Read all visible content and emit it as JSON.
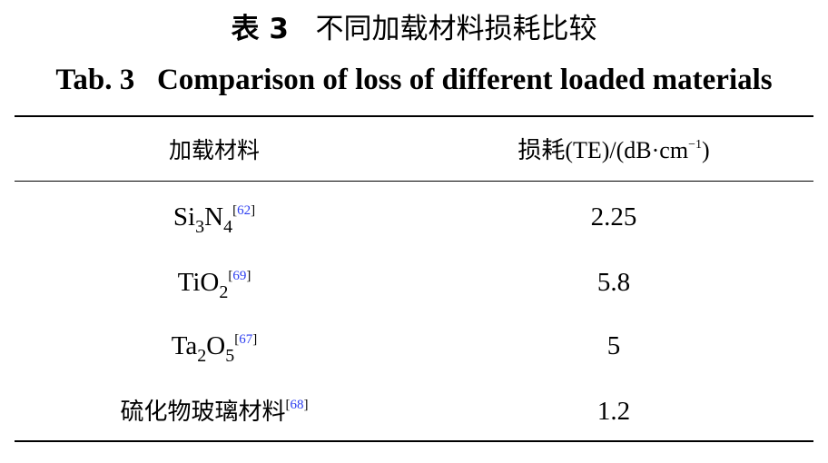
{
  "title": {
    "cn_label": "表 3",
    "cn_text": "不同加载材料损耗比较",
    "en_label": "Tab. 3",
    "en_text": "Comparison of loss of different loaded materials"
  },
  "table": {
    "header": {
      "col1": "加载材料",
      "col2_main": "损耗(TE)/(dB·cm",
      "col2_sup": "−1",
      "col2_close": ")"
    },
    "rows": [
      {
        "material_parts": [
          "Si",
          "3",
          "N",
          "4"
        ],
        "ref": "62",
        "loss": "2.25"
      },
      {
        "material_parts": [
          "TiO",
          "2"
        ],
        "ref": "69",
        "loss": "5.8"
      },
      {
        "material_parts": [
          "Ta",
          "2",
          "O",
          "5"
        ],
        "ref": "67",
        "loss": "5"
      },
      {
        "material_parts": [
          "硫化物玻璃材料"
        ],
        "ref": "68",
        "loss": "1.2"
      }
    ]
  },
  "colors": {
    "text": "#000000",
    "reference_link": "#2b3df0",
    "rule": "#000000"
  }
}
